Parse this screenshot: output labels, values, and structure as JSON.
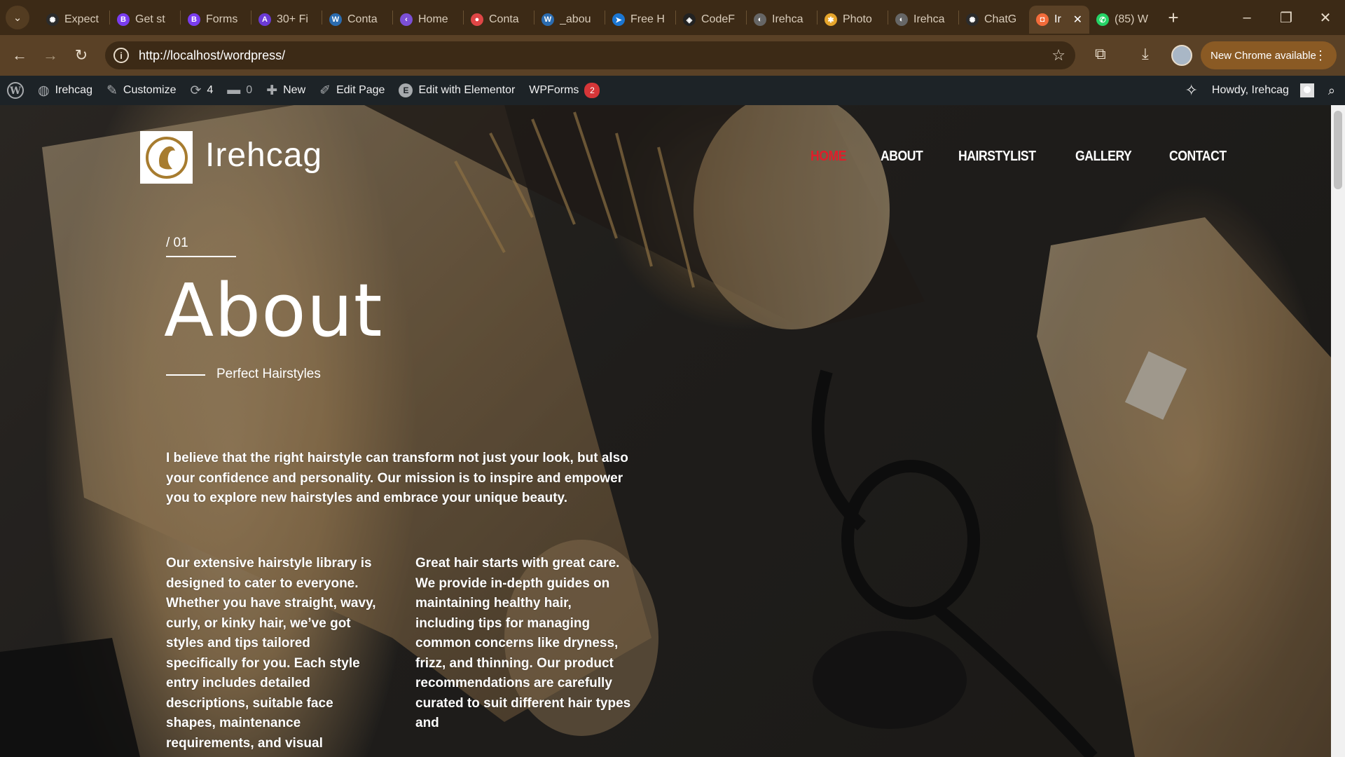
{
  "browser": {
    "tabs": [
      {
        "title": "Expect",
        "icon": "openai-icon",
        "color": "#2b2b2b"
      },
      {
        "title": "Get st",
        "icon": "bootstrap-icon",
        "color": "#7a3cf0"
      },
      {
        "title": "Forms",
        "icon": "bootstrap-icon",
        "color": "#7a3cf0"
      },
      {
        "title": "30+ Fi",
        "icon": "a-logo-icon",
        "color": "#6b3ad6"
      },
      {
        "title": "Conta",
        "icon": "wordpress-icon",
        "color": "#2b6cb0"
      },
      {
        "title": "Home",
        "icon": "chevron-logo-icon",
        "color": "#7b4fd6"
      },
      {
        "title": "Conta",
        "icon": "red-dot-icon",
        "color": "#e04646"
      },
      {
        "title": "_abou",
        "icon": "wordpress-icon",
        "color": "#2b6cb0"
      },
      {
        "title": "Free H",
        "icon": "arrow-logo-icon",
        "color": "#1b76d2"
      },
      {
        "title": "CodeF",
        "icon": "codepen-icon",
        "color": "#222"
      },
      {
        "title": "Irehca",
        "icon": "globe-icon",
        "color": "#666"
      },
      {
        "title": "Photo",
        "icon": "pinwheel-icon",
        "color": "#e6a52b"
      },
      {
        "title": "Irehca",
        "icon": "globe-icon",
        "color": "#666"
      },
      {
        "title": "ChatG",
        "icon": "openai-icon",
        "color": "#2b2b2b"
      },
      {
        "title": "Ir",
        "icon": "tab-logo-icon",
        "color": "#f26b3a",
        "active": true
      },
      {
        "title": "(85) W",
        "icon": "whatsapp-icon",
        "color": "#25d366"
      }
    ],
    "url": "http://localhost/wordpress/",
    "new_chrome": "New Chrome available"
  },
  "adminbar": {
    "site": "Irehcag",
    "customize": "Customize",
    "updates": "4",
    "comments": "0",
    "new": "New",
    "edit_page": "Edit Page",
    "elementor": "Edit with Elementor",
    "wpforms": "WPForms",
    "wpforms_count": "2",
    "howdy": "Howdy, Irehcag"
  },
  "site": {
    "title": "Irehcag",
    "nav": [
      "HOME",
      "ABOUT",
      "HAIRSTYLIST",
      "GALLERY",
      "CONTACT"
    ],
    "active_nav": "HOME",
    "active_color": "#e11d2a"
  },
  "hero": {
    "section_number": "/ 01",
    "heading": "About",
    "subtitle": "Perfect Hairstyles",
    "intro": "I believe that the right hairstyle can transform not just your look, but also your confidence and personality. Our mission is to inspire and empower you to explore new hairstyles and embrace your unique beauty.",
    "col1": "Our extensive hairstyle library is designed to cater to everyone. Whether you have straight, wavy, curly, or kinky hair, we’ve got styles and tips tailored specifically for you. Each style entry includes detailed descriptions, suitable face shapes, maintenance requirements, and visual",
    "col2": " Great hair starts with great care. We provide in-depth guides on maintaining healthy hair, including tips for managing common concerns like dryness, frizz, and thinning. Our product recommendations are carefully curated to suit different hair types and"
  }
}
